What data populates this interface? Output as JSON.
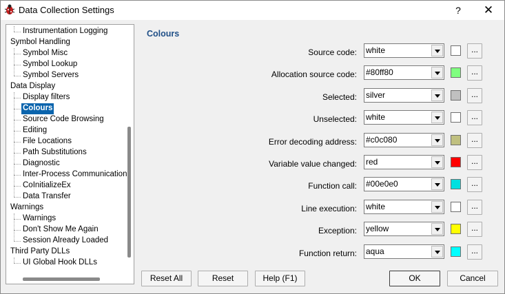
{
  "window": {
    "title": "Data Collection Settings",
    "help_label": "?",
    "close_label": "✕"
  },
  "tree": {
    "items": [
      {
        "label": "Instrumentation Logging",
        "level": 1
      },
      {
        "label": "Symbol Handling",
        "level": 0
      },
      {
        "label": "Symbol Misc",
        "level": 1
      },
      {
        "label": "Symbol Lookup",
        "level": 1
      },
      {
        "label": "Symbol Servers",
        "level": 1
      },
      {
        "label": "Data Display",
        "level": 0
      },
      {
        "label": "Display filters",
        "level": 1
      },
      {
        "label": "Colours",
        "level": 1,
        "selected": true
      },
      {
        "label": "Source Code Browsing",
        "level": 1
      },
      {
        "label": "Editing",
        "level": 1
      },
      {
        "label": "File Locations",
        "level": 1
      },
      {
        "label": "Path Substitutions",
        "level": 1
      },
      {
        "label": "Diagnostic",
        "level": 1
      },
      {
        "label": "Inter-Process Communication",
        "level": 1
      },
      {
        "label": "CoInitializeEx",
        "level": 1
      },
      {
        "label": "Data Transfer",
        "level": 1
      },
      {
        "label": "Warnings",
        "level": 0
      },
      {
        "label": "Warnings",
        "level": 1
      },
      {
        "label": "Don't Show Me Again",
        "level": 1
      },
      {
        "label": "Session Already Loaded",
        "level": 1
      },
      {
        "label": "Third Party DLLs",
        "level": 0
      },
      {
        "label": "UI Global Hook DLLs",
        "level": 1
      }
    ]
  },
  "content": {
    "title": "Colours",
    "rows": [
      {
        "label": "Source code:",
        "value": "white",
        "color": "#ffffff"
      },
      {
        "label": "Allocation source code:",
        "value": "#80ff80",
        "color": "#80ff80"
      },
      {
        "label": "Selected:",
        "value": "silver",
        "color": "#c0c0c0"
      },
      {
        "label": "Unselected:",
        "value": "white",
        "color": "#ffffff"
      },
      {
        "label": "Error decoding address:",
        "value": "#c0c080",
        "color": "#c0c080"
      },
      {
        "label": "Variable value changed:",
        "value": "red",
        "color": "#ff0000"
      },
      {
        "label": "Function call:",
        "value": "#00e0e0",
        "color": "#00e0e0"
      },
      {
        "label": "Line execution:",
        "value": "white",
        "color": "#ffffff"
      },
      {
        "label": "Exception:",
        "value": "yellow",
        "color": "#ffff00"
      },
      {
        "label": "Function return:",
        "value": "aqua",
        "color": "#00ffff"
      }
    ],
    "browse_label": "..."
  },
  "buttons": {
    "reset_all": "Reset All",
    "reset": "Reset",
    "help": "Help (F1)",
    "ok": "OK",
    "cancel": "Cancel"
  }
}
